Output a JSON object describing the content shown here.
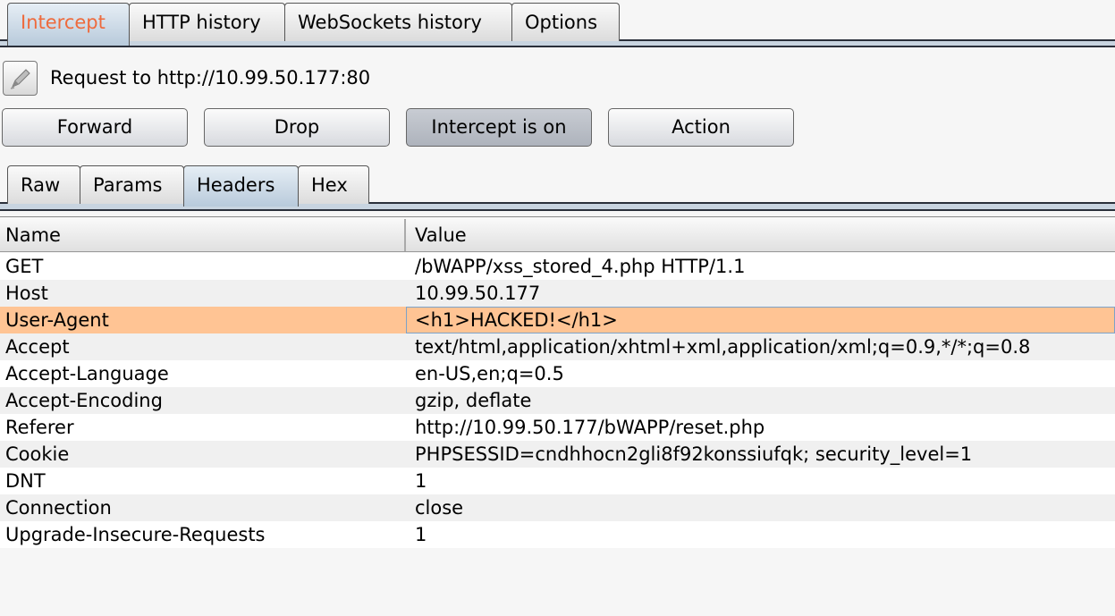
{
  "top_tabs": [
    {
      "label": "Intercept"
    },
    {
      "label": "HTTP history"
    },
    {
      "label": "WebSockets history"
    },
    {
      "label": "Options"
    }
  ],
  "request": {
    "label": "Request to http://10.99.50.177:80"
  },
  "buttons": {
    "forward": "Forward",
    "drop": "Drop",
    "intercept": "Intercept is on",
    "action": "Action"
  },
  "sub_tabs": [
    {
      "label": "Raw"
    },
    {
      "label": "Params"
    },
    {
      "label": "Headers"
    },
    {
      "label": "Hex"
    }
  ],
  "table": {
    "columns": [
      "Name",
      "Value"
    ],
    "rows": [
      {
        "name": "GET",
        "value": "/bWAPP/xss_stored_4.php HTTP/1.1"
      },
      {
        "name": "Host",
        "value": "10.99.50.177"
      },
      {
        "name": "User-Agent",
        "value": "<h1>HACKED!</h1>"
      },
      {
        "name": "Accept",
        "value": "text/html,application/xhtml+xml,application/xml;q=0.9,*/*;q=0.8"
      },
      {
        "name": "Accept-Language",
        "value": "en-US,en;q=0.5"
      },
      {
        "name": "Accept-Encoding",
        "value": "gzip, deflate"
      },
      {
        "name": "Referer",
        "value": "http://10.99.50.177/bWAPP/reset.php"
      },
      {
        "name": "Cookie",
        "value": "PHPSESSID=cndhhocn2gli8f92konssiufqk; security_level=1"
      },
      {
        "name": "DNT",
        "value": "1"
      },
      {
        "name": "Connection",
        "value": "close"
      },
      {
        "name": "Upgrade-Insecure-Requests",
        "value": "1"
      }
    ]
  },
  "colors": {
    "active_tab_text": "#ee6a3c",
    "selected_row": "#ffc494",
    "tab_active_bg": "#b8cadb"
  },
  "icons": {
    "edit": "pencil-icon"
  }
}
